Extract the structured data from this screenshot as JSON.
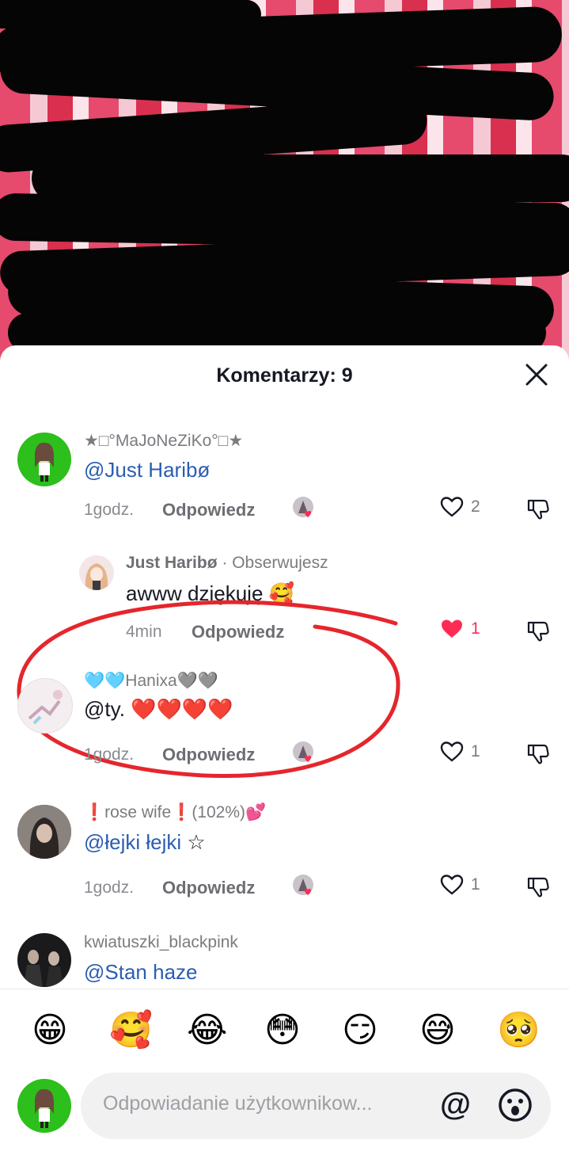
{
  "header": {
    "title": "Komentarzy: 9"
  },
  "comments": [
    {
      "username": "★□°MaJoNeZiKo°□★",
      "text": "@Just Haribø",
      "time": "1godz.",
      "reply_label": "Odpowiedz",
      "likes": "2",
      "liked": false
    },
    {
      "username": "Just Haribø",
      "following": "· Obserwujesz",
      "text": "awww dziękuję 🥰",
      "time": "4min",
      "reply_label": "Odpowiedz",
      "likes": "1",
      "liked": true
    },
    {
      "username": "🩵🩵Hanixa🩶🩶",
      "text": "@ty. ❤️❤️❤️❤️",
      "time": "1godz.",
      "reply_label": "Odpowiedz",
      "likes": "1",
      "liked": false
    },
    {
      "username": "❗rose wife❗(102%)💕",
      "text": "@łejki łejki",
      "text_suffix": " ☆",
      "time": "1godz.",
      "reply_label": "Odpowiedz",
      "likes": "1",
      "liked": false
    },
    {
      "username": "kwiatuszki_blackpink",
      "text": "@Stan haze"
    }
  ],
  "emoji_bar": [
    "😁",
    "🥰",
    "😂",
    "😳",
    "😏",
    "😅",
    "🥺"
  ],
  "input": {
    "placeholder": "Odpowiadanie użytkownikow...",
    "at_symbol": "@"
  },
  "colors": {
    "accent_mention": "#2b5db3",
    "like_red": "#fe2c55",
    "annotation_red": "#e5262c"
  },
  "icons": {
    "close": "close-icon",
    "like": "heart-icon",
    "dislike": "thumbs-down-icon",
    "emoji_picker": "smiley-icon"
  }
}
